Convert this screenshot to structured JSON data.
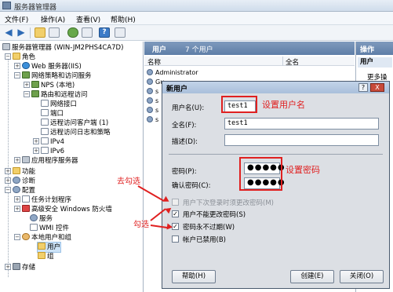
{
  "window": {
    "title": "服务器管理器"
  },
  "menu": [
    "文件(F)",
    "操作(A)",
    "查看(V)",
    "帮助(H)"
  ],
  "tree": {
    "root": "服务器管理器 (WIN-JM2PHS4CA7D)",
    "items": [
      "角色",
      "Web 服务器(IIS)",
      "网络策略和访问服务",
      "NPS (本地)",
      "路由和远程访问",
      "网络接口",
      "端口",
      "远程访问客户端 (1)",
      "远程访问日志和策略",
      "IPv4",
      "IPv6",
      "应用程序服务器",
      "功能",
      "诊断",
      "配置",
      "任务计划程序",
      "高级安全 Windows 防火墙",
      "服务",
      "WMI 控件",
      "本地用户和组",
      "用户",
      "组",
      "存储"
    ]
  },
  "center": {
    "header_title": "用户",
    "header_count": "7 个用户",
    "col_name": "名称",
    "col_fullname": "全名",
    "users": [
      "Administrator",
      "Gu",
      "s",
      "s",
      "s",
      "s"
    ]
  },
  "actions": {
    "header": "操作",
    "sub": "用户",
    "item": "更多操"
  },
  "dialog": {
    "title": "新用户",
    "help": "?",
    "close": "X",
    "username_label": "用户名(U):",
    "username_value": "test1",
    "fullname_label": "全名(F):",
    "fullname_value": "test1",
    "desc_label": "描述(D):",
    "desc_value": "",
    "password_label": "密码(P):",
    "password_value": "●●●●●",
    "confirm_label": "确认密码(C):",
    "confirm_value": "●●●●●",
    "chk_must_change": "用户下次登录时须更改密码(M)",
    "chk_cannot_change": "用户不能更改密码(S)",
    "chk_never_expire": "密码永不过期(W)",
    "chk_disabled": "帐户已禁用(B)",
    "check_mark": "✓",
    "btn_help": "帮助(H)",
    "btn_create": "创建(E)",
    "btn_close": "关闭(O)"
  },
  "annotations": {
    "set_username": "设置用户名",
    "set_password": "设置密码",
    "uncheck": "去勾选",
    "check": "勾选"
  }
}
